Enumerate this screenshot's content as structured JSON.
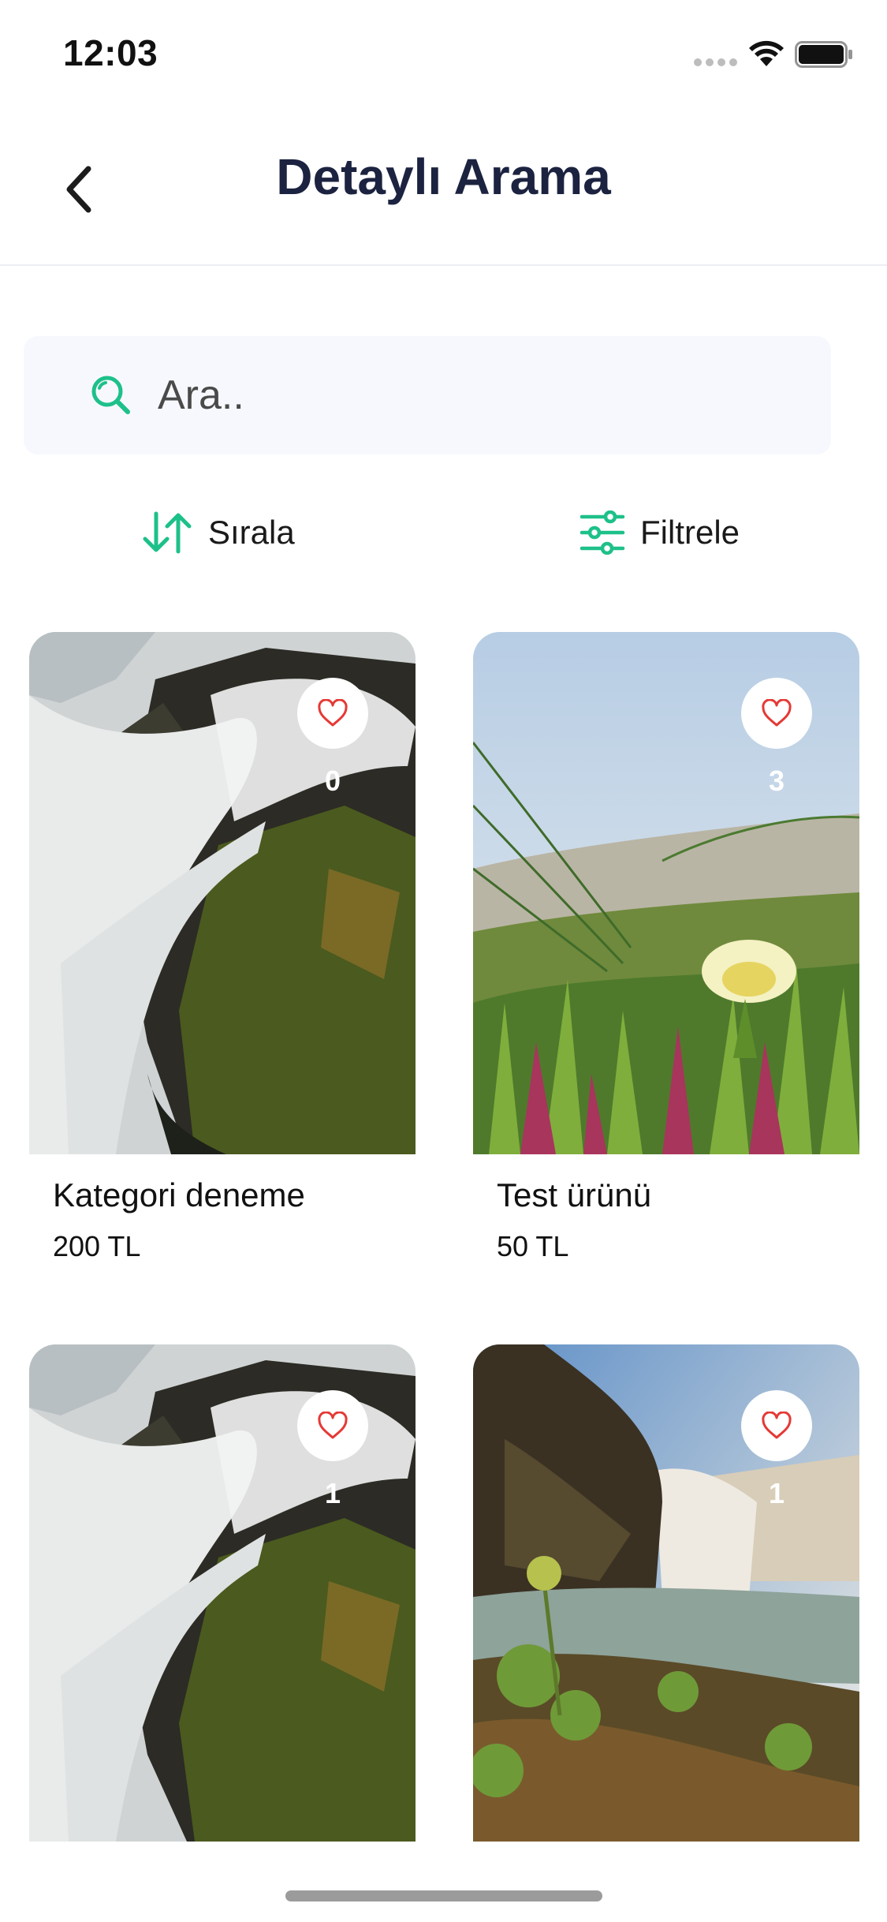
{
  "status_bar": {
    "time": "12:03"
  },
  "header": {
    "title": "Detaylı Arama"
  },
  "search": {
    "placeholder": "Ara.."
  },
  "actions": {
    "sort_label": "Sırala",
    "filter_label": "Filtrele"
  },
  "colors": {
    "accent": "#1ec08a",
    "title": "#1c2340",
    "heart": "#e53935",
    "search_bg": "#f7f8fd"
  },
  "products": [
    {
      "title": "Kategori deneme",
      "price": "200 TL",
      "favorites": "0",
      "image": "waterfall-rocks"
    },
    {
      "title": "Test ürünü",
      "price": "50 TL",
      "favorites": "3",
      "image": "flower-field"
    },
    {
      "title": "",
      "price": "",
      "favorites": "1",
      "image": "waterfall-rocks"
    },
    {
      "title": "",
      "price": "",
      "favorites": "1",
      "image": "waterfall-landscape"
    }
  ]
}
